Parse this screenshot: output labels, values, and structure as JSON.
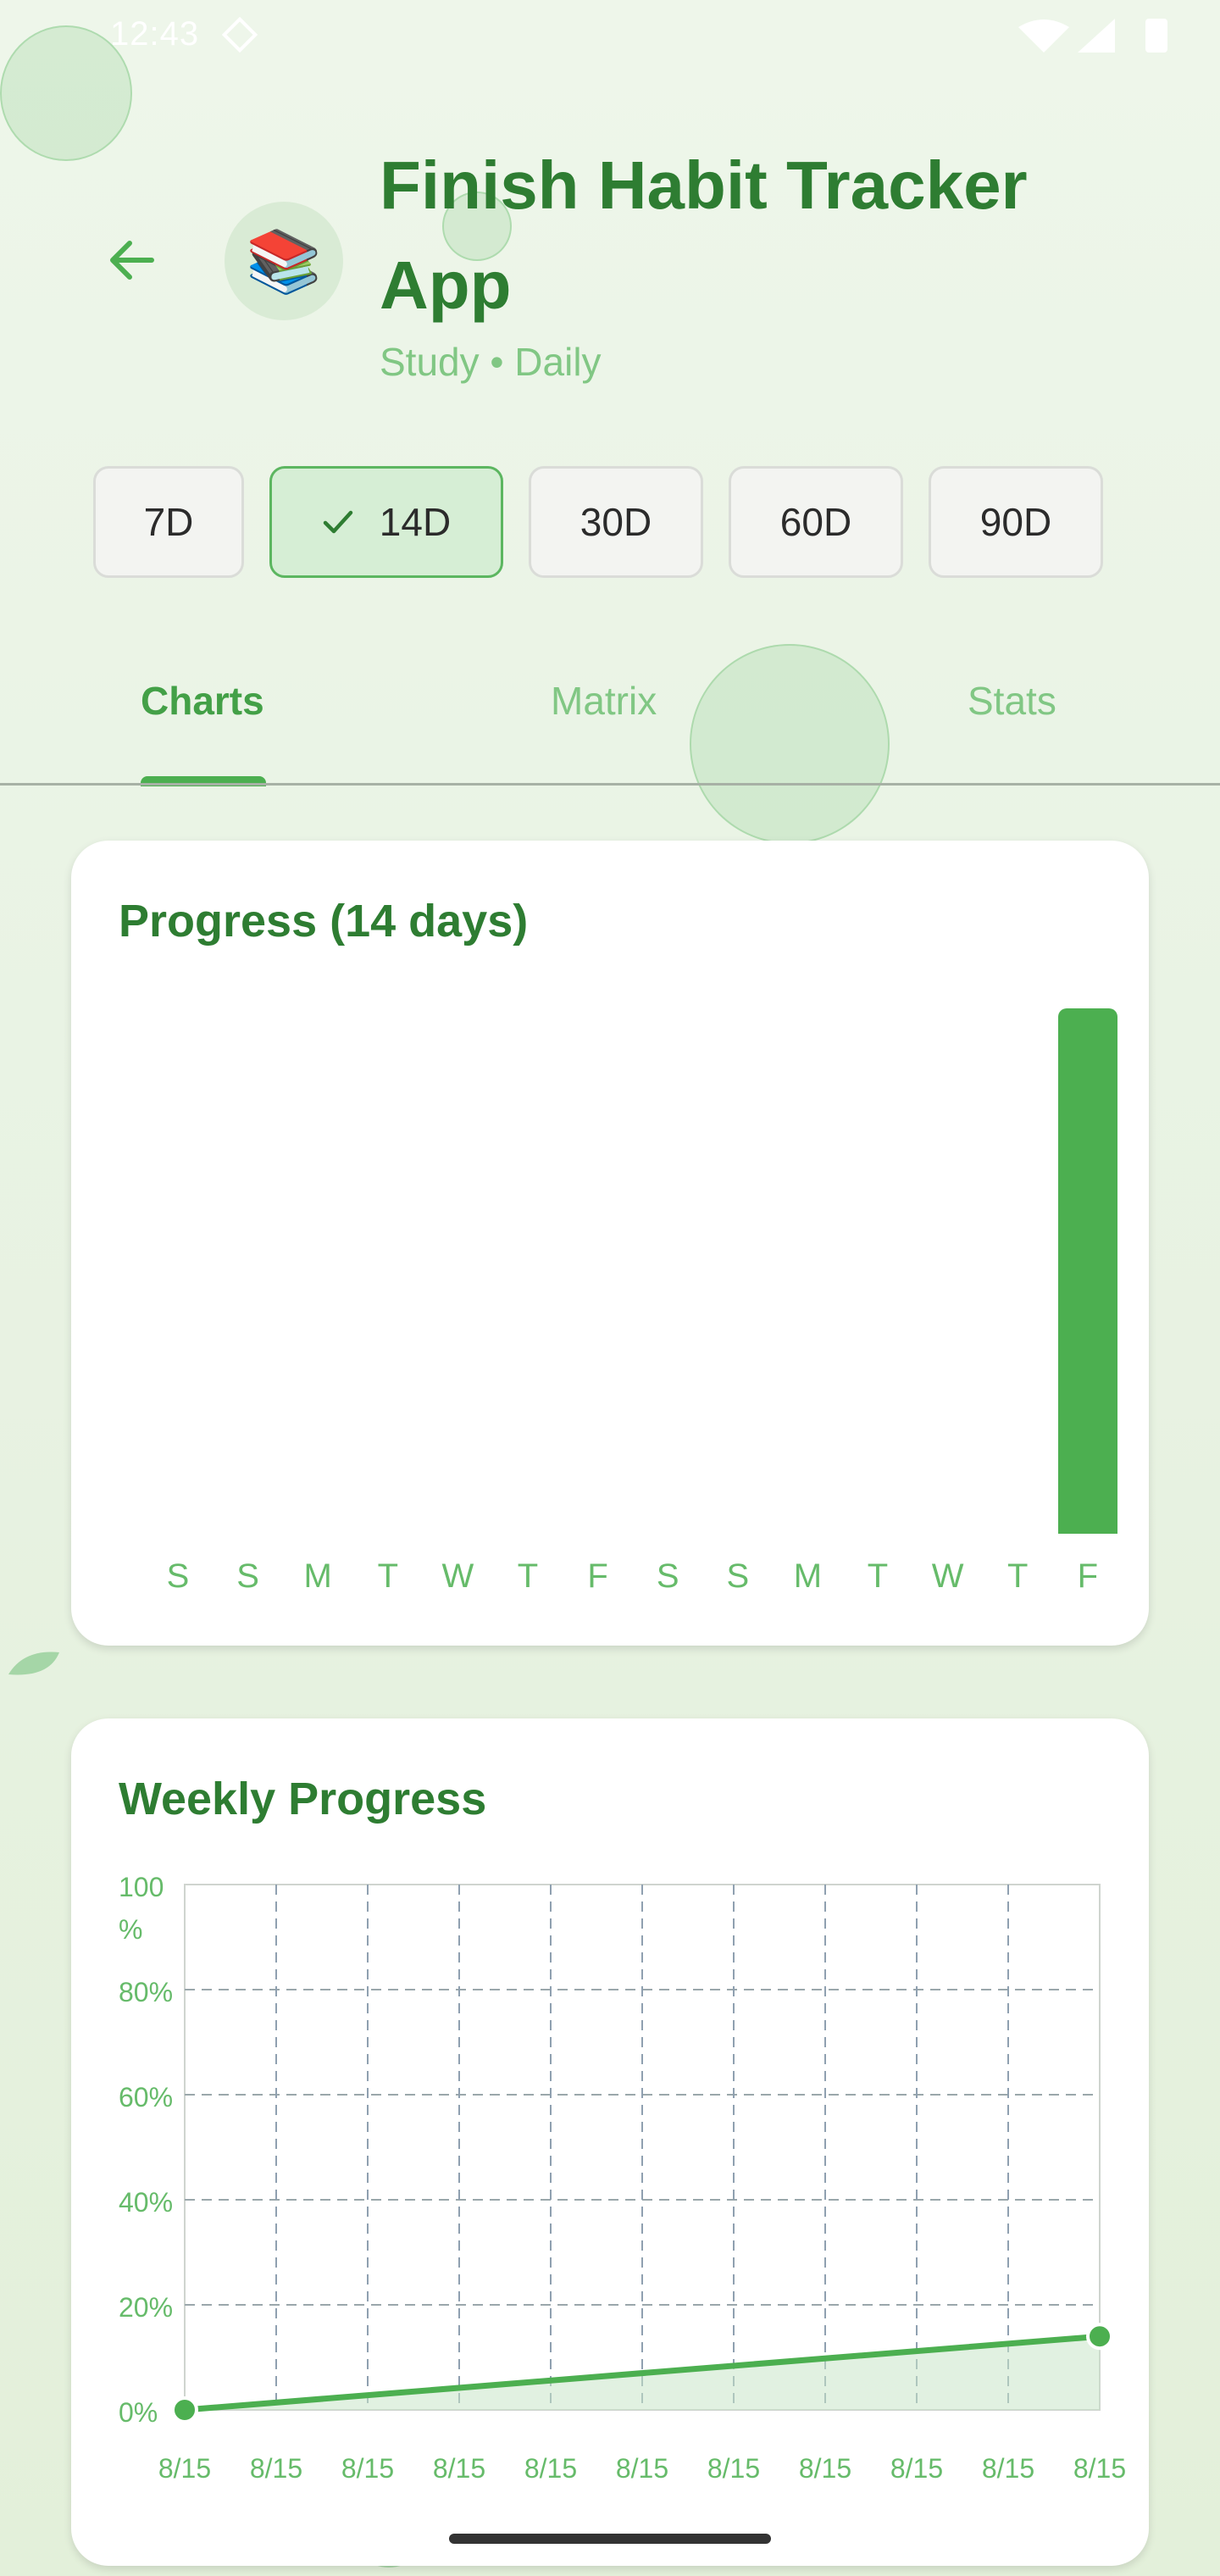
{
  "status_bar": {
    "time": "12:43",
    "icons": [
      "notification-diamond-icon",
      "wifi-icon",
      "signal-icon",
      "battery-icon"
    ]
  },
  "header": {
    "back_icon": "arrow-left-icon",
    "habit_icon": "📚",
    "title": "Finish Habit Tracker App",
    "subtitle": "Study • Daily"
  },
  "ranges": [
    {
      "label": "7D",
      "selected": false
    },
    {
      "label": "14D",
      "selected": true
    },
    {
      "label": "30D",
      "selected": false
    },
    {
      "label": "60D",
      "selected": false
    },
    {
      "label": "90D",
      "selected": false
    }
  ],
  "tabs": [
    {
      "label": "Charts",
      "active": true
    },
    {
      "label": "Matrix",
      "active": false
    },
    {
      "label": "Stats",
      "active": false
    }
  ],
  "colors": {
    "primary": "#4caf50",
    "primary_dark": "#2e7d32",
    "light_text": "#81c784"
  },
  "progress_card": {
    "title": "Progress (14 days)",
    "chart_data": {
      "type": "bar",
      "title": "Progress (14 days)",
      "categories": [
        "S",
        "S",
        "M",
        "T",
        "W",
        "T",
        "F",
        "S",
        "S",
        "M",
        "T",
        "W",
        "T",
        "F"
      ],
      "values": [
        0,
        0,
        0,
        0,
        0,
        0,
        0,
        0,
        0,
        0,
        0,
        0,
        0,
        1
      ],
      "ylim": [
        0,
        1
      ]
    }
  },
  "weekly_card": {
    "title": "Weekly Progress",
    "chart_data": {
      "type": "area",
      "title": "Weekly Progress",
      "x": [
        "8/15",
        "8/15",
        "8/15",
        "8/15",
        "8/15",
        "8/15",
        "8/15",
        "8/15",
        "8/15",
        "8/15",
        "8/15"
      ],
      "y_ticks": [
        "0%",
        "20%",
        "40%",
        "60%",
        "80%",
        "100\n%"
      ],
      "ylim": [
        0,
        100
      ],
      "points": [
        {
          "x_index": 0,
          "y": 0
        },
        {
          "x_index": 10,
          "y": 14
        }
      ],
      "grid": true
    }
  }
}
